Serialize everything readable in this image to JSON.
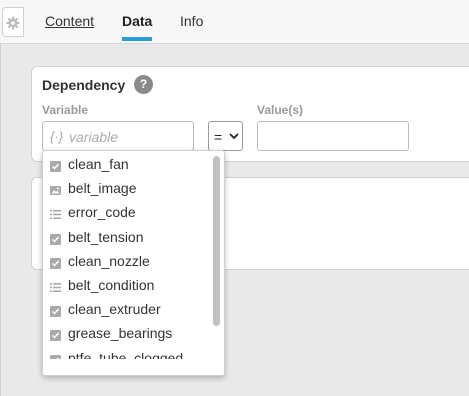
{
  "tabs": {
    "content": "Content",
    "data": "Data",
    "info": "Info"
  },
  "dependency": {
    "title": "Dependency",
    "help_icon": "?",
    "variable_label": "Variable",
    "variable_placeholder_icon": "{·}",
    "variable_placeholder": "variable",
    "operator": "=",
    "values_label": "Value(s)"
  },
  "dropdown": {
    "items": [
      {
        "label": "clean_fan",
        "icon": "checkbox-icon"
      },
      {
        "label": "belt_image",
        "icon": "image-icon"
      },
      {
        "label": "error_code",
        "icon": "list-icon"
      },
      {
        "label": "belt_tension",
        "icon": "checkbox-icon"
      },
      {
        "label": "clean_nozzle",
        "icon": "checkbox-icon"
      },
      {
        "label": "belt_condition",
        "icon": "list-icon"
      },
      {
        "label": "clean_extruder",
        "icon": "checkbox-icon"
      },
      {
        "label": "grease_bearings",
        "icon": "checkbox-icon"
      },
      {
        "label": "ptfe_tube_clogged",
        "icon": "checkbox-icon"
      }
    ]
  },
  "colors": {
    "accent": "#2a9bd7",
    "background": "#e9e9e9"
  }
}
